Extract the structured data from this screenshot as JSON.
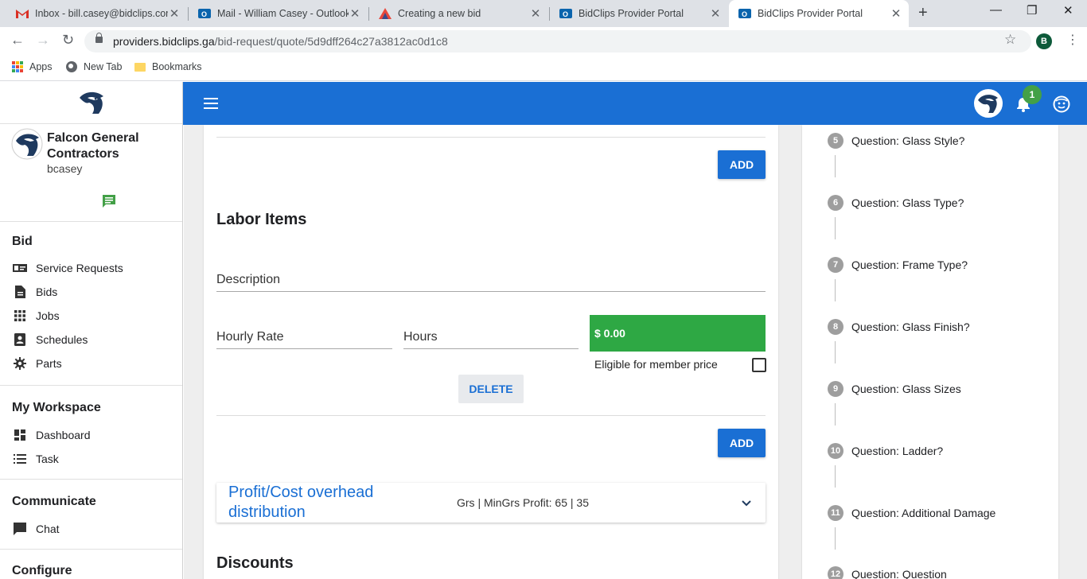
{
  "browser": {
    "tabs": [
      {
        "title": "Inbox - bill.casey@bidclips.com",
        "icon": "gmail-icon"
      },
      {
        "title": "Mail - William Casey - Outlook",
        "icon": "outlook-icon"
      },
      {
        "title": "Creating a new bid",
        "icon": "bidclips-triangle-icon"
      },
      {
        "title": "BidClips Provider Portal",
        "icon": "outlook-icon"
      },
      {
        "title": "BidClips Provider Portal",
        "icon": "outlook-icon",
        "active": true
      }
    ],
    "url_host": "providers.bidclips.ga",
    "url_path": "/bid-request/quote/5d9dff264c27a3812ac0d1c8",
    "profile_initial": "B",
    "bookmarks": [
      {
        "label": "Apps",
        "icon": "apps-grid-icon"
      },
      {
        "label": "New Tab",
        "icon": "globe-icon"
      },
      {
        "label": "Bookmarks",
        "icon": "folder-icon"
      }
    ]
  },
  "sidebar": {
    "company_name": "Falcon General Contractors",
    "username": "bcasey",
    "sections": [
      {
        "heading": "Bid",
        "items": [
          "Service Requests",
          "Bids",
          "Jobs",
          "Schedules",
          "Parts"
        ]
      },
      {
        "heading": "My Workspace",
        "items": [
          "Dashboard",
          "Task"
        ]
      },
      {
        "heading": "Communicate",
        "items": [
          "Chat"
        ]
      },
      {
        "heading": "Configure",
        "items": []
      }
    ]
  },
  "topbar": {
    "notification_count": "1"
  },
  "main": {
    "add_label": "ADD",
    "labor_title": "Labor Items",
    "description_label": "Description",
    "hourly_rate_label": "Hourly Rate",
    "hours_label": "Hours",
    "price": "$ 0.00",
    "eligible_label": "Eligible for member price",
    "eligible_checked": false,
    "delete_label": "DELETE",
    "profit_title": "Profit/Cost overhead distribution",
    "profit_value": "Grs | MinGrs Profit: 65 | 35",
    "discounts_title": "Discounts"
  },
  "questions": [
    {
      "num": "5",
      "text": "Question: Glass Style?"
    },
    {
      "num": "6",
      "text": "Question: Glass Type?"
    },
    {
      "num": "7",
      "text": "Question: Frame Type?"
    },
    {
      "num": "8",
      "text": "Question: Glass Finish?"
    },
    {
      "num": "9",
      "text": "Question: Glass Sizes"
    },
    {
      "num": "10",
      "text": "Question: Ladder?"
    },
    {
      "num": "11",
      "text": "Question: Additional Damage"
    },
    {
      "num": "12",
      "text": "Question: Question"
    }
  ],
  "colors": {
    "primary": "#1a6fd4",
    "success": "#2ea844",
    "badge": "#43a047"
  }
}
